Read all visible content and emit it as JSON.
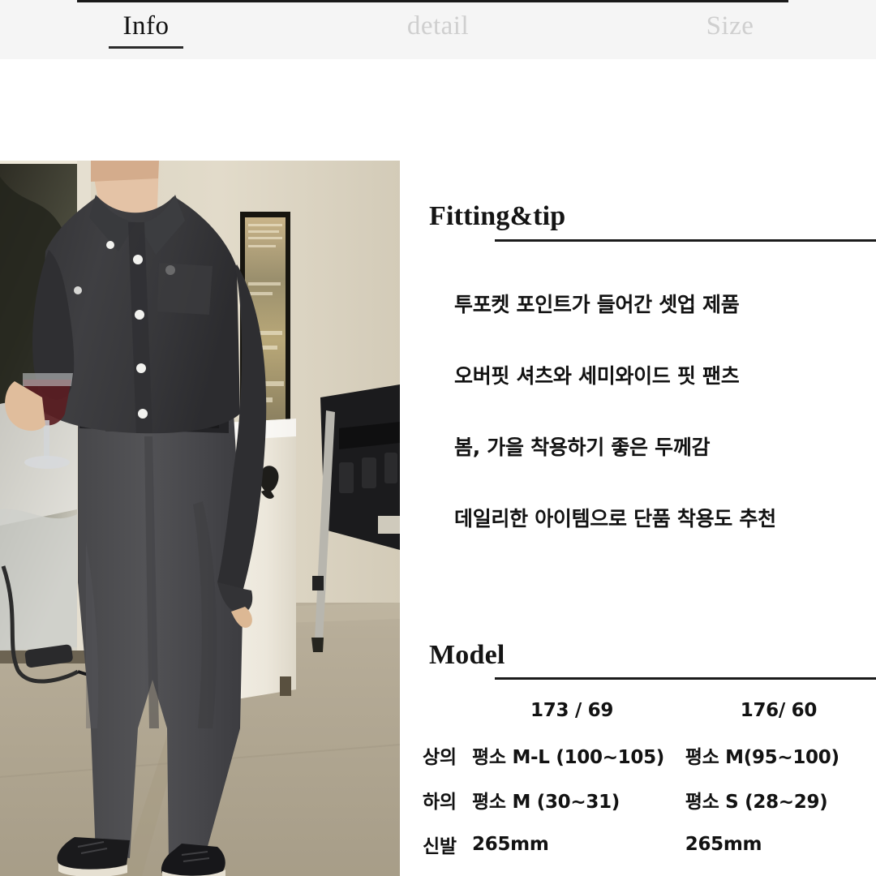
{
  "tabs": [
    {
      "label": "Info",
      "active": true
    },
    {
      "label": "detail",
      "active": false
    },
    {
      "label": "Size",
      "active": false
    }
  ],
  "fitting": {
    "heading": "Fitting&tip",
    "bullets": [
      "투포켓 포인트가 들어간 셋업 제품",
      "오버핏 셔츠와 세미와이드 핏 팬츠",
      "봄, 가을 착용하기 좋은 두께감",
      "데일리한 아이템으로 단품 착용도 추천"
    ]
  },
  "model": {
    "heading": "Model",
    "columns": [
      "",
      "173 / 69",
      "176/ 60"
    ],
    "rows": [
      {
        "label": "상의",
        "a": "평소 M-L (100~105)",
        "b": "평소 M(95~100)"
      },
      {
        "label": "하의",
        "a": "평소 M (30~31)",
        "b": "평소 S (28~29)"
      },
      {
        "label": "신발",
        "a": "265mm",
        "b": "265mm"
      }
    ]
  },
  "photo": {
    "alt": "model-wearing-charcoal-shirt-and-wide-pants-holding-wine-glass",
    "colors": {
      "wall": "#ded7c6",
      "floor": "#b5ab97",
      "garment": "#3b3b3d",
      "cabinet": "#f3efe6",
      "frame": "#1d1a16"
    }
  },
  "theme": {
    "tabbar_bg": "#f5f5f5",
    "page_bg": "#ffffff",
    "ink": "#121212",
    "muted": "#cfcfcf",
    "rule": "#1b1b1b"
  }
}
